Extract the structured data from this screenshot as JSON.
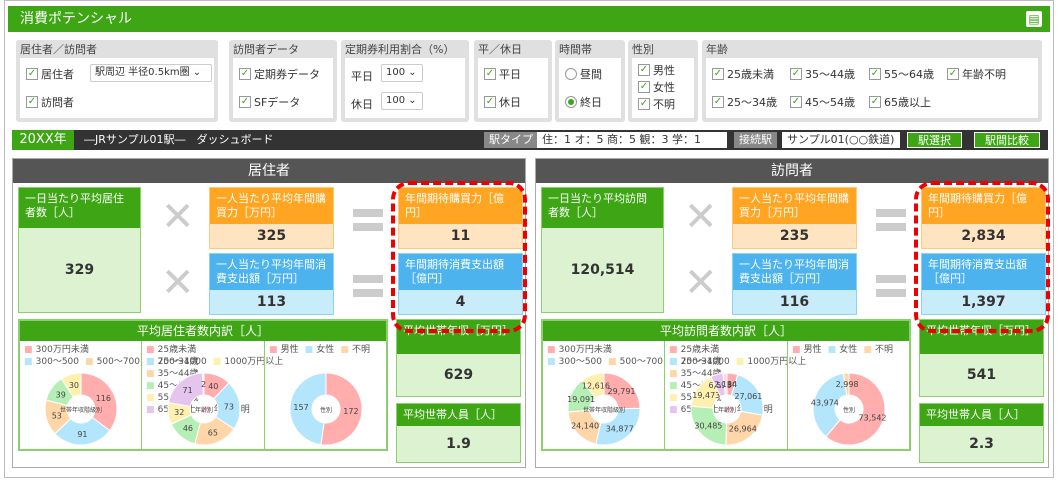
{
  "app": {
    "title": "消費ポテンシャル",
    "print_icon": "printer-icon"
  },
  "filters": {
    "resident_visitor": {
      "label": "居住者／訪問者",
      "resident": "居住者",
      "area_select": "駅周辺 半径0.5km圏",
      "visitor": "訪問者"
    },
    "visitor_data": {
      "label": "訪問者データ",
      "commuter": "定期券データ",
      "sf": "SFデータ"
    },
    "commuter_ratio": {
      "label": "定期券利用割合（%）",
      "weekday": "平日",
      "weekday_value": "100",
      "holiday": "休日",
      "holiday_value": "100"
    },
    "day_type": {
      "label": "平／休日",
      "weekday": "平日",
      "holiday": "休日"
    },
    "time": {
      "label": "時間帯",
      "daytime": "昼間",
      "allday": "終日",
      "selected": "終日"
    },
    "gender": {
      "label": "性別",
      "male": "男性",
      "female": "女性",
      "unknown": "不明"
    },
    "age": {
      "label": "年齢",
      "items": [
        "25歳未満",
        "35～44歳",
        "55～64歳",
        "年齢不明",
        "25～34歳",
        "45～54歳",
        "65歳以上"
      ]
    }
  },
  "dashboard": {
    "year": "20XX年",
    "title": "―JRサンプル01駅―　ダッシュボード",
    "station_type_label": "駅タイプ",
    "station_type_value": "住：1 オ：5 商：5 観：3 学：1",
    "connect_label": "接続駅",
    "connect_value": "サンプル01(○○鉄道)",
    "select_button": "駅選択",
    "compare_button": "駅間比較"
  },
  "colors": {
    "green": "#3ea614",
    "orange": "#ffa521",
    "blue": "#4db3ee",
    "highlight": "#e00000"
  },
  "resident": {
    "title": "居住者",
    "daily": {
      "label": "一日当たり平均居住者数［人］",
      "value": "329"
    },
    "purchase": {
      "label": "一人当たり平均年間購買力［万円］",
      "value": "325"
    },
    "spend": {
      "label": "一人当たり平均年間消費支出額［万円］",
      "value": "113"
    },
    "total_purchase": {
      "label": "年間期待購買力［億円］",
      "value": "11"
    },
    "total_spend": {
      "label": "年間期待消費支出額［億円］",
      "value": "4"
    },
    "income": {
      "label": "平均世帯年収［万円］",
      "value": "629"
    },
    "household": {
      "label": "平均世帯人員［人］",
      "value": "1.9"
    },
    "breakdown_title": "平均居住者数内訳［人］"
  },
  "visitor": {
    "title": "訪問者",
    "daily": {
      "label": "一日当たり平均訪問者数［人］",
      "value": "120,514"
    },
    "purchase": {
      "label": "一人当たり平均年間購買力［万円］",
      "value": "235"
    },
    "spend": {
      "label": "一人当たり平均年間消費支出額［万円］",
      "value": "116"
    },
    "total_purchase": {
      "label": "年間期待購買力［億円］",
      "value": "2,834"
    },
    "total_spend": {
      "label": "年間期待消費支出額［億円］",
      "value": "1,397"
    },
    "income": {
      "label": "平均世帯年収［万円］",
      "value": "541"
    },
    "household": {
      "label": "平均世帯人員［人］",
      "value": "2.3"
    },
    "breakdown_title": "平均訪問者数内訳［人］"
  },
  "chart_data": [
    {
      "type": "pie",
      "panel": "resident",
      "title": "世帯年収階級別",
      "categories": [
        "300万円未満",
        "300～500",
        "500～700",
        "700～1000",
        "1000万円以上"
      ],
      "values": [
        116,
        91,
        53,
        39,
        30
      ]
    },
    {
      "type": "pie",
      "panel": "resident",
      "title": "年齢別",
      "categories": [
        "25歳未満",
        "25～34歳",
        "35～44歳",
        "45～54歳",
        "55～64歳",
        "65歳以上",
        "年齢不明"
      ],
      "values": [
        40,
        73,
        65,
        46,
        32,
        71,
        2
      ]
    },
    {
      "type": "pie",
      "panel": "resident",
      "title": "性別",
      "categories": [
        "男性",
        "女性",
        "不明"
      ],
      "values": [
        172,
        157,
        0
      ]
    },
    {
      "type": "pie",
      "panel": "visitor",
      "title": "世帯年収階級別",
      "categories": [
        "300万円未満",
        "300～500",
        "500～700",
        "700～1000",
        "1000万円以上"
      ],
      "values": [
        29791,
        34877,
        24140,
        19091,
        12616
      ]
    },
    {
      "type": "pie",
      "panel": "visitor",
      "title": "年齢別",
      "categories": [
        "25歳未満",
        "25～34歳",
        "35～44歳",
        "45～54歳",
        "55～64歳",
        "65歳以上",
        "年齢不明"
      ],
      "values": [
        5802,
        27061,
        26964,
        30485,
        19473,
        6595,
        2134
      ]
    },
    {
      "type": "pie",
      "panel": "visitor",
      "title": "性別",
      "categories": [
        "男性",
        "女性",
        "不明"
      ],
      "values": [
        73542,
        43974,
        2998
      ]
    }
  ],
  "pie_colors": [
    "#ffadad",
    "#b3e5fc",
    "#ffd6a8",
    "#b5efb5",
    "#fff0b0",
    "#e5c4ee",
    "#ffd6e8"
  ]
}
